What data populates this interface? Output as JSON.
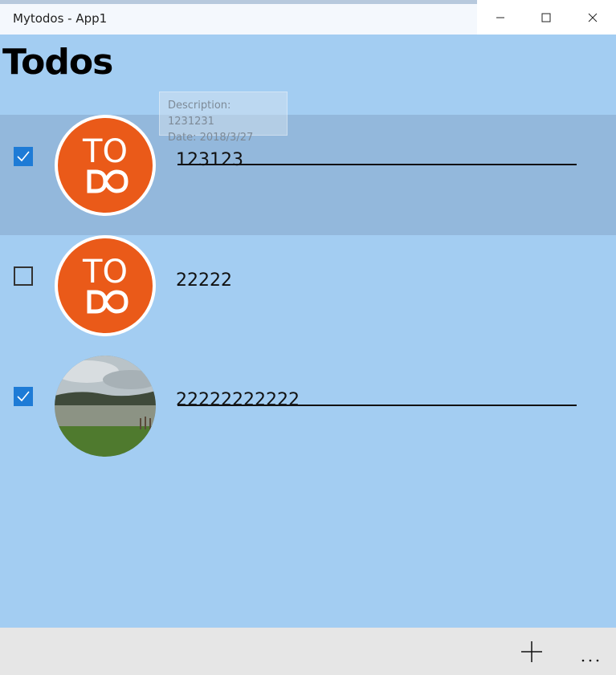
{
  "window": {
    "title": "Mytodos - App1"
  },
  "page": {
    "title": "Todos"
  },
  "tooltip": {
    "description": "Description: 1231231",
    "date": "Date: 2018/3/27"
  },
  "todos": [
    {
      "title": "123123",
      "checked": true,
      "image": "todo-logo",
      "selected": true
    },
    {
      "title": "22222",
      "checked": false,
      "image": "todo-logo",
      "selected": false
    },
    {
      "title": "22222222222",
      "checked": true,
      "image": "landscape-photo",
      "selected": false
    }
  ],
  "logo": {
    "line1": "TO",
    "line2": "DO"
  },
  "appbar": {
    "buttons": [
      "add-icon",
      "more-icon"
    ]
  },
  "colors": {
    "background": "#a3cdf2",
    "selected_row": "#93b8dc",
    "checkbox": "#1e7bd6",
    "logo_orange": "#ea5a19",
    "appbar": "#e6e6e6"
  }
}
